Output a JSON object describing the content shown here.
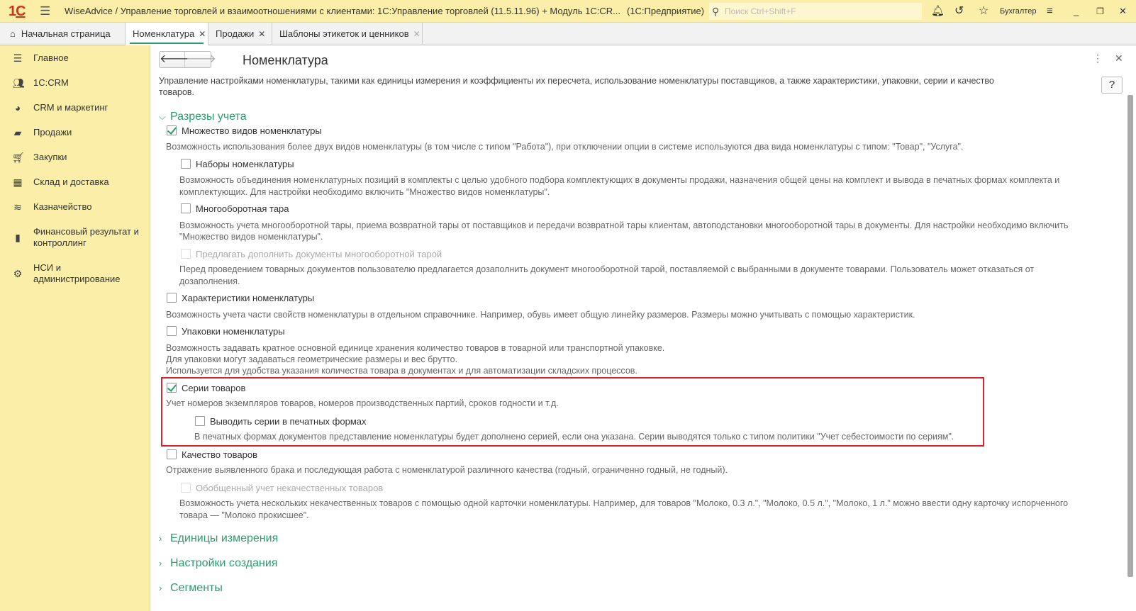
{
  "titlebar": {
    "logo": "1С",
    "title": "WiseAdvice / Управление торговлей и взаимоотношениями с клиентами: 1С:Управление торговлей (11.5.11.96) + Модуль 1С:CR...",
    "mode": "(1С:Предприятие)",
    "search_placeholder": "Поиск Ctrl+Shift+F",
    "user": "Бухгалтер"
  },
  "tabs": [
    {
      "label": "Начальная страница"
    },
    {
      "label": "Номенклатура",
      "active": true
    },
    {
      "label": "Продажи"
    },
    {
      "label": "Шаблоны этикеток и ценников"
    }
  ],
  "sidebar": [
    {
      "label": "Главное",
      "icon": "menu-icon"
    },
    {
      "label": "1С:CRM",
      "icon": "users-icon"
    },
    {
      "label": "CRM и маркетинг",
      "icon": "pie-icon"
    },
    {
      "label": "Продажи",
      "icon": "bag-icon"
    },
    {
      "label": "Закупки",
      "icon": "cart-icon"
    },
    {
      "label": "Склад и доставка",
      "icon": "warehouse-icon"
    },
    {
      "label": "Казначейство",
      "icon": "coins-icon"
    },
    {
      "label": "Финансовый результат и контроллинг",
      "icon": "chart-icon"
    },
    {
      "label": "НСИ и администрирование",
      "icon": "gear-icon"
    }
  ],
  "page": {
    "title": "Номенклатура",
    "help": "?",
    "description": "Управление настройками номенклатуры, такими как единицы измерения и коэффициенты их пересчета, использование номенклатуры поставщиков, а также характеристики, упаковки, серии и качество товаров.",
    "group1": "Разрезы учета",
    "options": [
      {
        "label": "Множество видов номенклатуры",
        "checked": true,
        "desc": "Возможность использования более двух видов номенклатуры (в том числе с типом \"Работа\"), при отключении опции в системе используются два вида номенклатуры с типом: \"Товар\", \"Услуга\"."
      },
      {
        "label": "Наборы номенклатуры",
        "checked": false,
        "desc1": "Возможность объединения номенклатурных позиций в комплекты с целью удобного подбора комплектующих в документы продажи, назначения общей цены на комплект и вывода в печатных формах комплекта и",
        "desc2": "комплектующих. Для настройки необходимо включить \"Множество видов номенклатуры\"."
      },
      {
        "label": "Многооборотная тара",
        "checked": false,
        "desc1": "Возможность учета многооборотной тары, приема возвратной тары от поставщиков и передачи возвратной тары клиентам, автоподстановки многооборотной тары в документы. Для настройки необходимо включить",
        "desc2": "\"Множество видов номенклатуры\"."
      },
      {
        "label": "Предлагать дополнить документы многооборотной тарой",
        "checked": false,
        "disabled": true,
        "desc1": "Перед проведением товарных документов пользователю предлагается дозаполнить документ многооборотной тарой, поставляемой с выбранными в документе товарами. Пользователь может отказаться от",
        "desc2": "дозаполнения."
      },
      {
        "label": "Характеристики номенклатуры",
        "checked": false,
        "desc": "Возможность учета части свойств номенклатуры в отдельном справочнике. Например, обувь имеет общую линейку размеров. Размеры можно учитывать с помощью характеристик."
      },
      {
        "label": "Упаковки номенклатуры",
        "checked": false,
        "desc1": "Возможность задавать кратное основной единице хранения количество товаров в товарной или транспортной упаковке.",
        "desc2": "Для упаковки могут задаваться геометрические размеры и вес брутто.",
        "desc3": "Используется для удобства указания количества товара в документах и для автоматизации складских процессов."
      },
      {
        "label": "Серии товаров",
        "checked": true,
        "desc": "Учет номеров экземпляров товаров, номеров производственных партий, сроков годности и т.д."
      },
      {
        "label": "Выводить серии в печатных формах",
        "checked": false,
        "desc": "В печатных формах документов представление номенклатуры будет дополнено серией, если она указана. Серии выводятся только с типом политики \"Учет себестоимости по сериям\"."
      },
      {
        "label": "Качество товаров",
        "checked": false,
        "desc": "Отражение выявленного брака и последующая работа с номенклатурой различного качества (годный, ограниченно годный, не годный)."
      },
      {
        "label": "Обобщенный учет некачественных товаров",
        "checked": false,
        "disabled": true,
        "desc1": "Возможность учета нескольких некачественных товаров с помощью одной карточки номенклатуры. Например, для товаров \"Молоко, 0.3 л.\", \"Молоко, 0.5 л.\", \"Молоко, 1 л.\" можно ввести одну карточку испорченного",
        "desc2": "товара — \"Молоко прокисшее\"."
      }
    ],
    "collapsed_groups": [
      "Единицы измерения",
      "Настройки создания",
      "Сегменты"
    ]
  },
  "colors": {
    "accent": "#2a9d6a",
    "highlight": "#d9232e",
    "panel": "#fbeea8"
  }
}
